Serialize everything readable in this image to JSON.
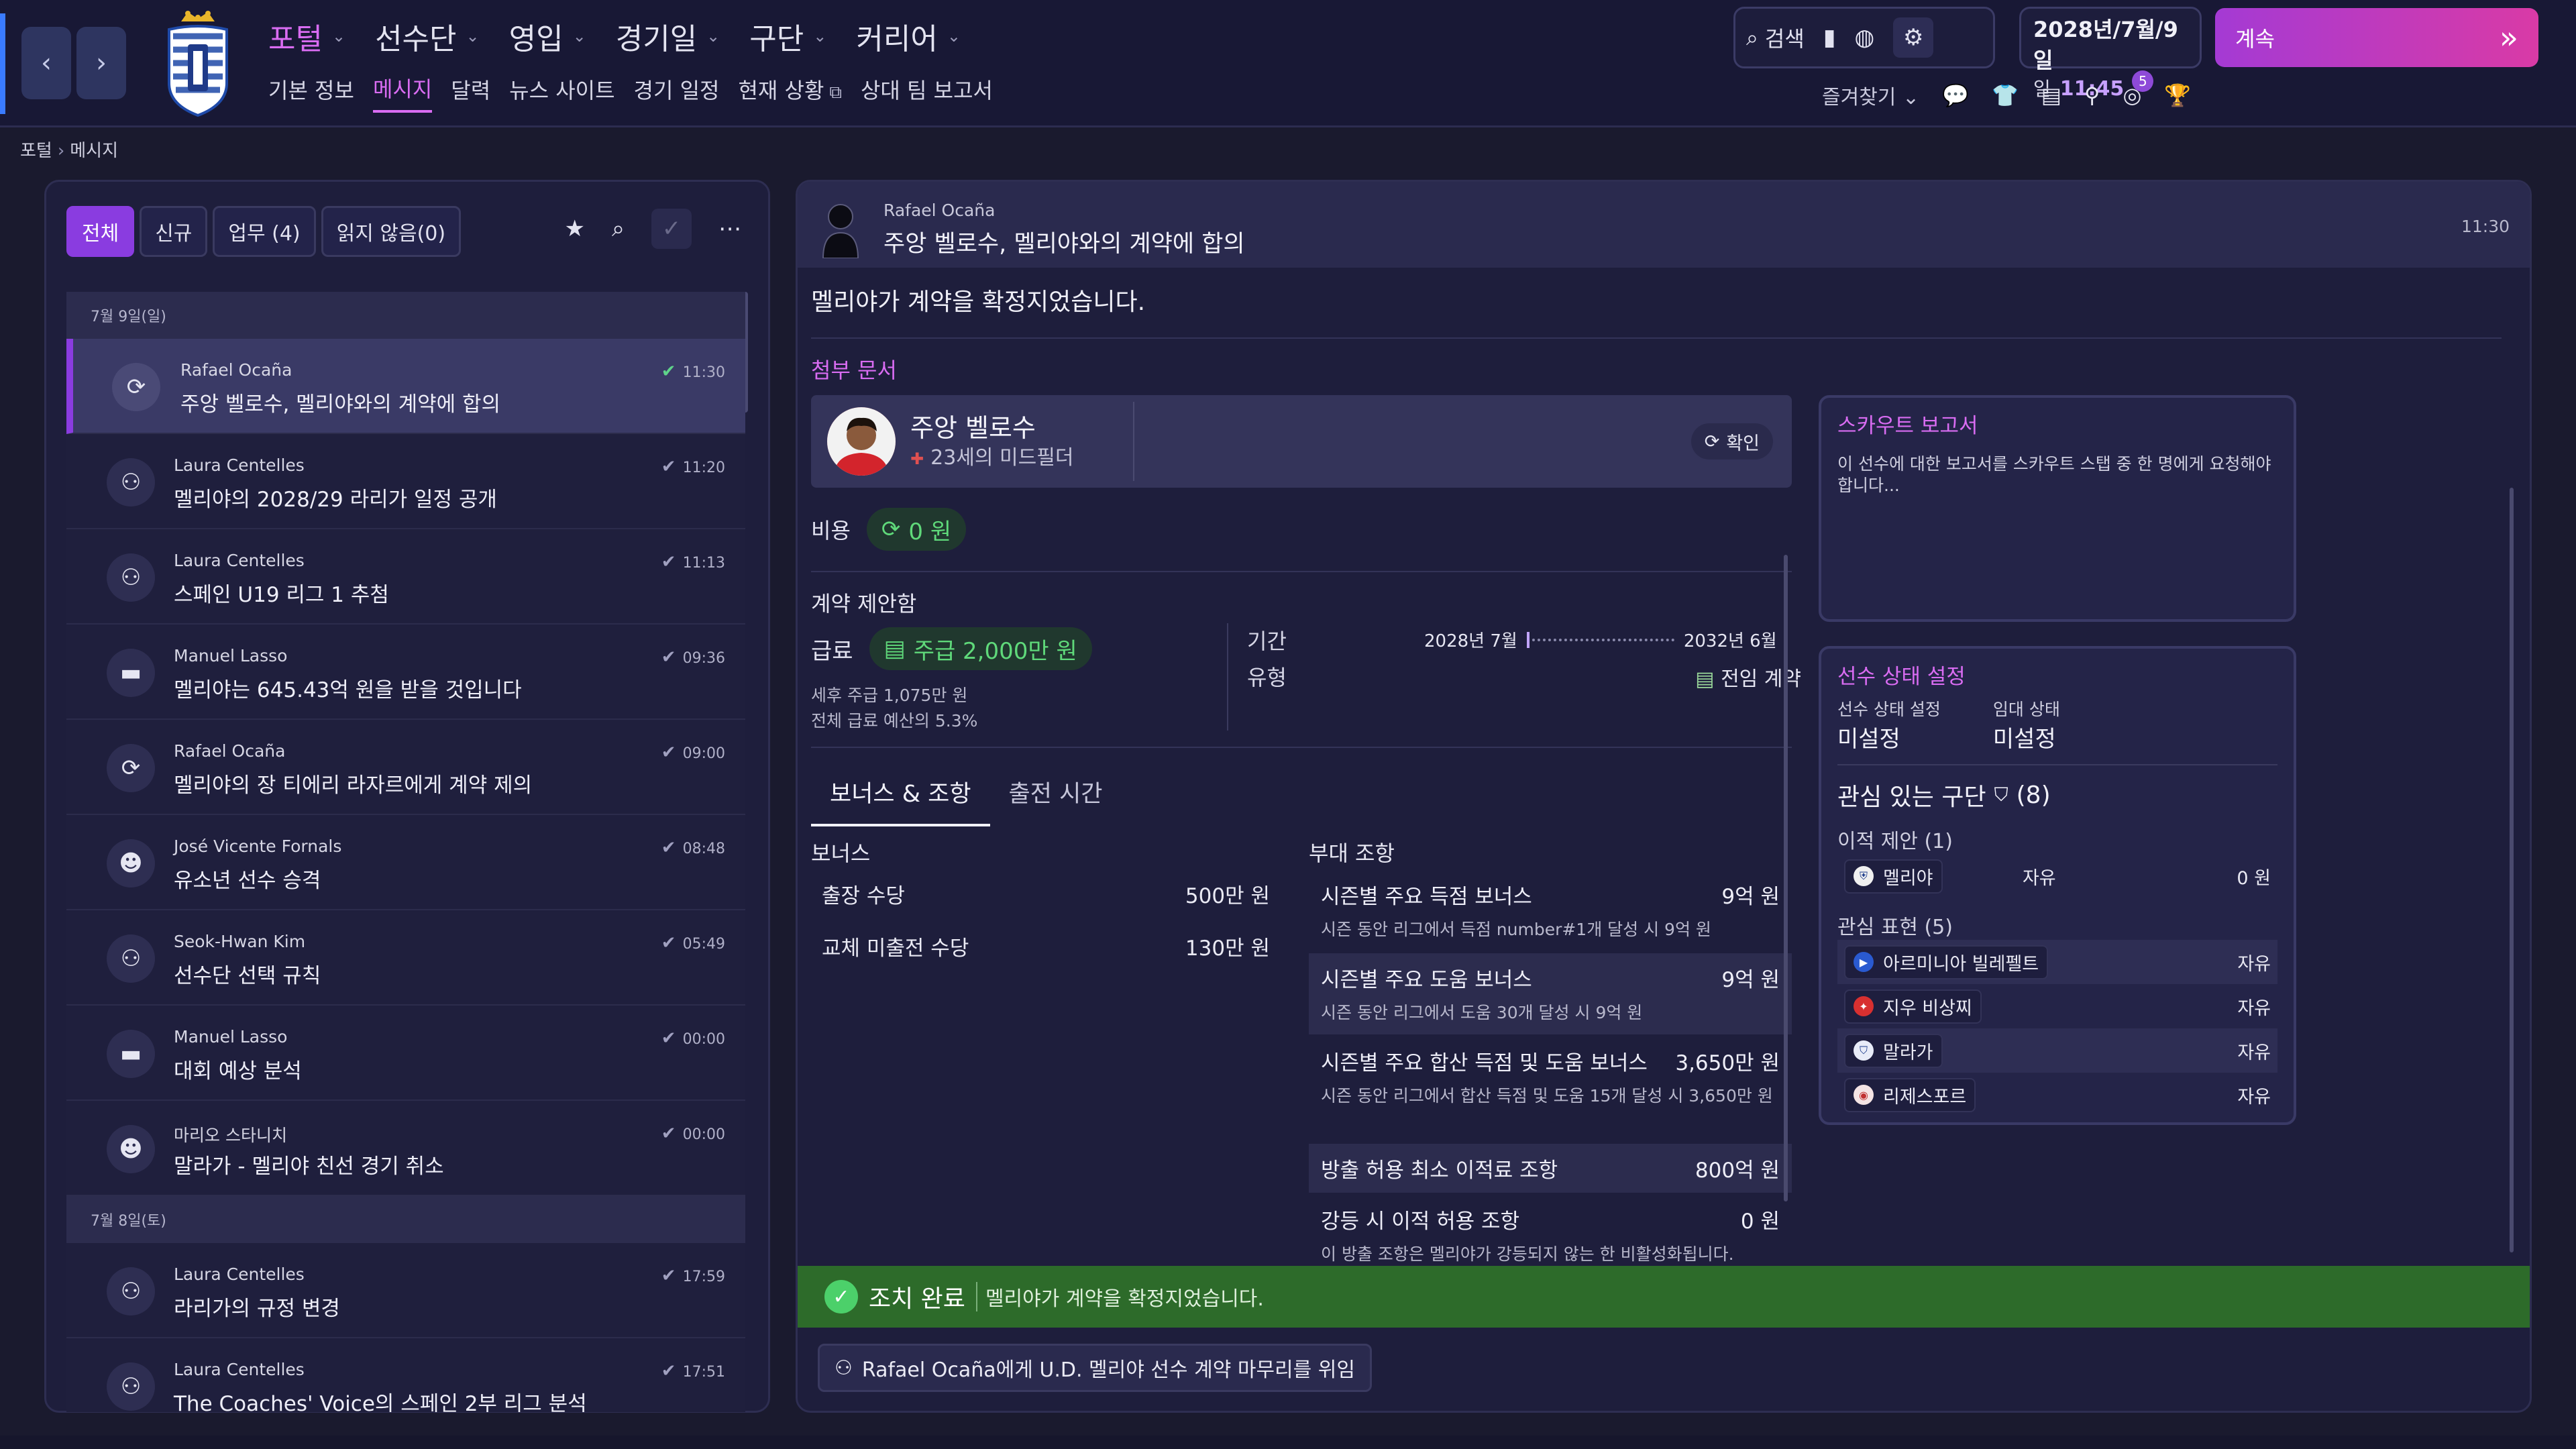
{
  "nav": {
    "back_icon": "chevron-left-icon",
    "forward_icon": "chevron-right-icon",
    "main": [
      {
        "label": "포털"
      },
      {
        "label": "선수단"
      },
      {
        "label": "영입"
      },
      {
        "label": "경기일"
      },
      {
        "label": "구단"
      },
      {
        "label": "커리어"
      }
    ],
    "sub": [
      {
        "label": "기본 정보"
      },
      {
        "label": "메시지"
      },
      {
        "label": "달력"
      },
      {
        "label": "뉴스 사이트"
      },
      {
        "label": "경기 일정"
      },
      {
        "label": "현재 상황"
      },
      {
        "label": "상대 팀 보고서"
      }
    ]
  },
  "toolbar": {
    "search_label": "검색",
    "date_line": "2028년/7월/9일",
    "day_label": "일",
    "time": "11:45",
    "continue_label": "계속",
    "favorites_label": "즐겨찾기",
    "notification_count": "5"
  },
  "breadcrumb": {
    "root": "포털",
    "current": "메시지"
  },
  "filters": [
    {
      "label": "전체"
    },
    {
      "label": "신규"
    },
    {
      "label": "업무 (4)"
    },
    {
      "label": "읽지 않음(0)"
    }
  ],
  "messages": [
    {
      "type": "day",
      "label": "7월 9일(일)"
    },
    {
      "from": "Rafael Ocaña",
      "subject": "주앙 벨로수, 멜리야와의 계약에 합의",
      "time": "11:30",
      "icon": "refresh-icon"
    },
    {
      "from": "Laura Centelles",
      "subject": "멜리야의 2028/29 라리가 일정 공개",
      "time": "11:20",
      "icon": "staff-icon"
    },
    {
      "from": "Laura Centelles",
      "subject": "스페인 U19 리그 1 추첨",
      "time": "11:13",
      "icon": "staff-icon"
    },
    {
      "from": "Manuel Lasso",
      "subject": "멜리야는 645.43억 원을 받을 것입니다",
      "time": "09:36",
      "icon": "briefcase-icon"
    },
    {
      "from": "Rafael Ocaña",
      "subject": "멜리야의 장 티에리 라자르에게 계약 제의",
      "time": "09:00",
      "icon": "refresh-icon"
    },
    {
      "from": "José Vicente Fornals",
      "subject": "유소년 선수 승격",
      "time": "08:48",
      "icon": "youth-icon"
    },
    {
      "from": "Seok-Hwan Kim",
      "subject": "선수단 선택 규칙",
      "time": "05:49",
      "icon": "staff-icon"
    },
    {
      "from": "Manuel Lasso",
      "subject": "대회 예상 분석",
      "time": "00:00",
      "icon": "briefcase-icon"
    },
    {
      "from": "마리오 스타니치",
      "subject": "말라가 - 멜리야 친선 경기 취소",
      "time": "00:00",
      "icon": "youth-icon"
    },
    {
      "type": "day",
      "label": "7월 8일(토)"
    },
    {
      "from": "Laura Centelles",
      "subject": "라리가의 규정 변경",
      "time": "17:59",
      "icon": "staff-icon"
    },
    {
      "from": "Laura Centelles",
      "subject": "The Coaches' Voice의 스페인 2부 리그 분석",
      "time": "17:51",
      "icon": "staff-icon"
    }
  ],
  "detail": {
    "from": "Rafael Ocaña",
    "subject": "주앙 벨로수, 멜리야와의 계약에 합의",
    "time": "11:30",
    "body": "멜리야가 계약을 확정지었습니다.",
    "attachments_label": "첨부 문서",
    "player": {
      "name": "주앙 벨로수",
      "desc": "23세의 미드필더",
      "confirm_label": "확인"
    },
    "cost_label": "비용",
    "cost_value": "0 원",
    "contract_title": "계약 제안함",
    "salary_label": "급료",
    "salary_value": "주급 2,000만 원",
    "salary_after_tax": "세후 주급 1,075만 원",
    "salary_budget": "전체 급료 예산의 5.3%",
    "term_label": "기간",
    "term_start": "2028년 7월",
    "term_end": "2032년 6월",
    "type_label": "유형",
    "type_value": "전임 계약",
    "tabs": [
      {
        "label": "보너스 & 조항"
      },
      {
        "label": "출전 시간"
      }
    ],
    "bonus_header": "보너스",
    "bonuses": [
      {
        "label": "출장 수당",
        "value": "500만 원"
      },
      {
        "label": "교체 미출전 수당",
        "value": "130만 원"
      }
    ],
    "clauses_header": "부대 조항",
    "clauses": [
      {
        "label": "시즌별 주요 득점 보너스",
        "value": "9억 원",
        "sub": "시즌 동안 리그에서 득점 number#1개 달성 시 9억 원"
      },
      {
        "label": "시즌별 주요 도움 보너스",
        "value": "9억 원",
        "sub": "시즌 동안 리그에서 도움 30개 달성 시 9억 원"
      },
      {
        "label": "시즌별 주요 합산 득점 및 도움 보너스",
        "value": "3,650만 원",
        "sub": "시즌 동안 리그에서 합산 득점 및 도움 15개 달성 시 3,650만 원"
      },
      {
        "label": "방출 허용 최소 이적료 조항",
        "value": "800억 원",
        "sub": ""
      },
      {
        "label": "강등 시 이적 허용 조항",
        "value": "0 원",
        "sub": "이 방출 조항은 멜리야가 강등되지 않는 한 비활성화됩니다."
      }
    ],
    "scout": {
      "title": "스카우트 보고서",
      "desc": "이 선수에 대한 보고서를 스카우트 스탭 중 한 명에게 요청해야 합니다..."
    },
    "status": {
      "title": "선수 상태 설정",
      "status_key": "선수 상태 설정",
      "status_val": "미설정",
      "loan_key": "임대 상태",
      "loan_val": "미설정",
      "clubs_title": "관심 있는 구단",
      "clubs_count": "(8)",
      "offers_title": "이적 제안 (1)",
      "offers": [
        {
          "club": "멜리야",
          "status": "자유",
          "fee": "0 원"
        }
      ],
      "interest_title": "관심 표현 (5)",
      "interest": [
        {
          "club": "아르미니아 빌레펠트",
          "status": "자유"
        },
        {
          "club": "지우 비상찌",
          "status": "자유"
        },
        {
          "club": "말라가",
          "status": "자유"
        },
        {
          "club": "리제스포르",
          "status": "자유"
        }
      ]
    },
    "action_title": "조치 완료",
    "action_desc": "멜리야가 계약을 확정지었습니다.",
    "delegate_label": "Rafael Ocaña에게 U.D. 멜리야 선수 계약 마무리를 위임"
  }
}
